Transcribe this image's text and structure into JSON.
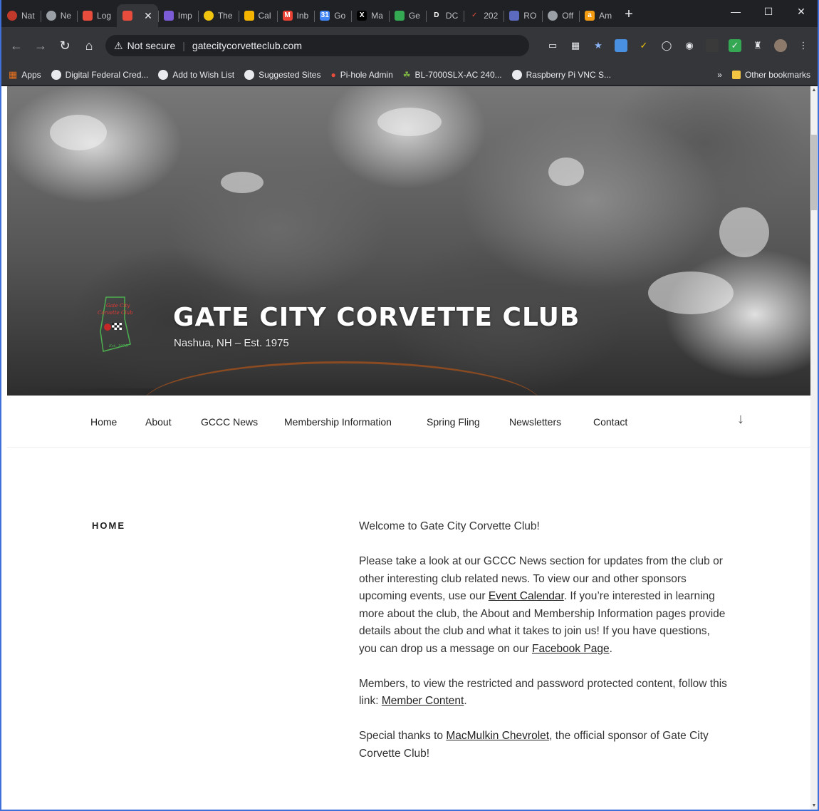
{
  "tabs": [
    {
      "label": "Nat",
      "icon": "globe-icon",
      "color": "#c0392b"
    },
    {
      "label": "Ne",
      "icon": "globe-icon",
      "color": "#9aa0a6"
    },
    {
      "label": "Log",
      "icon": "corvette-flag-icon",
      "color": "#e74c3c"
    },
    {
      "label": "",
      "icon": "corvette-flag-icon",
      "color": "#e74c3c",
      "active": true
    },
    {
      "label": "Imp",
      "icon": "shield-icon",
      "color": "#7b5cd6"
    },
    {
      "label": "The",
      "icon": "smiley-icon",
      "color": "#f1c40f"
    },
    {
      "label": "Cal",
      "icon": "link-icon",
      "color": "#f5b400"
    },
    {
      "label": "Inb",
      "icon": "gmail-icon",
      "color": "#ea4335"
    },
    {
      "label": "Go",
      "icon": "calendar-icon",
      "color": "#4285f4"
    },
    {
      "label": "Ma",
      "icon": "x-icon",
      "color": "#ffffff"
    },
    {
      "label": "Ge",
      "icon": "grid-icon",
      "color": "#34a853"
    },
    {
      "label": "DC",
      "icon": "d-icon",
      "color": "#ffffff"
    },
    {
      "label": "202",
      "icon": "check-icon",
      "color": "#e74c3c"
    },
    {
      "label": "RO",
      "icon": "ro-icon",
      "color": "#5c6bc0"
    },
    {
      "label": "Off",
      "icon": "globe-icon",
      "color": "#9aa0a6"
    },
    {
      "label": "Am",
      "icon": "amazon-icon",
      "color": "#f39c12"
    }
  ],
  "omnibox": {
    "security": "Not secure",
    "url": "gatecitycorvetteclub.com"
  },
  "bookmarks": [
    {
      "label": "Apps",
      "icon": "apps-grid-icon"
    },
    {
      "label": "Digital Federal Cred...",
      "icon": "globe-icon"
    },
    {
      "label": "Add to Wish List",
      "icon": "globe-icon"
    },
    {
      "label": "Suggested Sites",
      "icon": "globe-icon"
    },
    {
      "label": "Pi-hole Admin",
      "icon": "pihole-icon"
    },
    {
      "label": "BL-7000SLX-AC 240...",
      "icon": "leaf-icon"
    },
    {
      "label": "Raspberry Pi VNC S...",
      "icon": "globe-icon"
    }
  ],
  "bookmarks_more": "»",
  "other_bookmarks": "Other bookmarks",
  "site": {
    "title": "GATE CITY CORVETTE CLUB",
    "description": "Nashua, NH – Est. 1975"
  },
  "nav": [
    "Home",
    "About",
    "GCCC News",
    "Membership Information",
    "Spring Fling",
    "Newsletters",
    "Contact"
  ],
  "page": {
    "title": "HOME",
    "p1": "Welcome to Gate City Corvette Club!",
    "p2_a": "Please take a look at our GCCC News section for updates from the club or other interesting club related news.  To view our and other sponsors upcoming events, use our ",
    "p2_link1": "Event Calendar",
    "p2_b": ".  If you’re interested in learning more about the club, the About and Membership Information pages provide details about the club and what it takes to join us!  If you have questions, you can drop us a message on our ",
    "p2_link2": "Facebook Page",
    "p2_c": ".",
    "p3_a": "Members, to view the restricted and password protected content, follow this link:  ",
    "p3_link": "Member Content",
    "p3_b": ".",
    "p4_a": "Special thanks to ",
    "p4_link": "MacMulkin Chevrolet",
    "p4_b": ", the official sponsor of Gate City Corvette Club!"
  }
}
